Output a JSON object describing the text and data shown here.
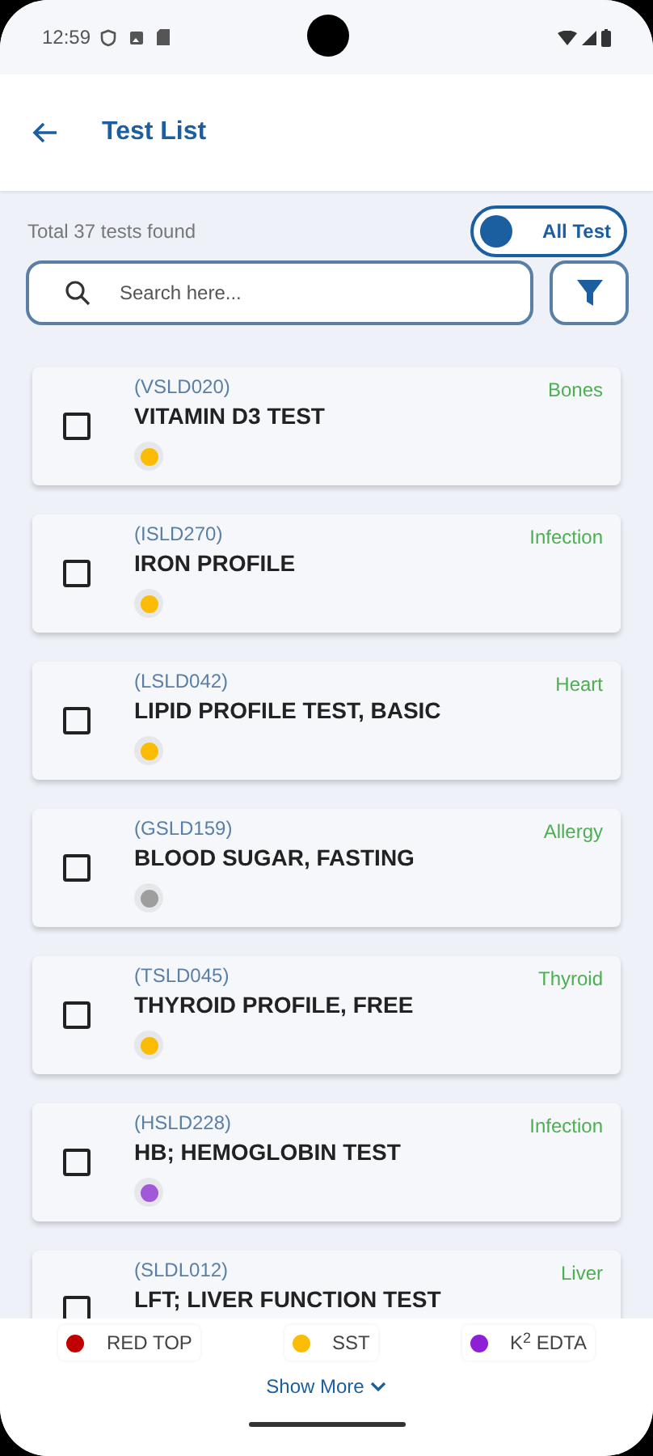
{
  "status_bar": {
    "time": "12:59"
  },
  "header": {
    "title": "Test List"
  },
  "summary": "Total 37 tests found",
  "toggle": {
    "label": "All Test",
    "on": false
  },
  "search": {
    "placeholder": "Search here..."
  },
  "tests": [
    {
      "code": "(VSLD020)",
      "name": "VITAMIN D3 TEST",
      "category": "Bones",
      "checked": false,
      "color": "#fbbc05"
    },
    {
      "code": "(ISLD270)",
      "name": "IRON PROFILE",
      "category": "Infection",
      "checked": false,
      "color": "#fbbc05"
    },
    {
      "code": "(LSLD042)",
      "name": "LIPID PROFILE TEST, BASIC",
      "category": "Heart",
      "checked": false,
      "color": "#fbbc05"
    },
    {
      "code": "(GSLD159)",
      "name": "BLOOD SUGAR, FASTING",
      "category": "Allergy",
      "checked": false,
      "color": "#9e9e9e"
    },
    {
      "code": "(TSLD045)",
      "name": "THYROID PROFILE, FREE",
      "category": "Thyroid",
      "checked": false,
      "color": "#fbbc05"
    },
    {
      "code": "(HSLD228)",
      "name": "HB; HEMOGLOBIN TEST",
      "category": "Infection",
      "checked": false,
      "color": "#a259d9"
    },
    {
      "code": "(SLDL012)",
      "name": "LFT; LIVER FUNCTION TEST",
      "category": "Liver",
      "checked": false
    }
  ],
  "legend": [
    {
      "label": "RED TOP",
      "color": "#c00000"
    },
    {
      "label": "SST",
      "color": "#fbbc05"
    },
    {
      "label": "K$^{2}$ EDTA",
      "color": "#8e1fd6"
    }
  ],
  "show_more": "Show More"
}
